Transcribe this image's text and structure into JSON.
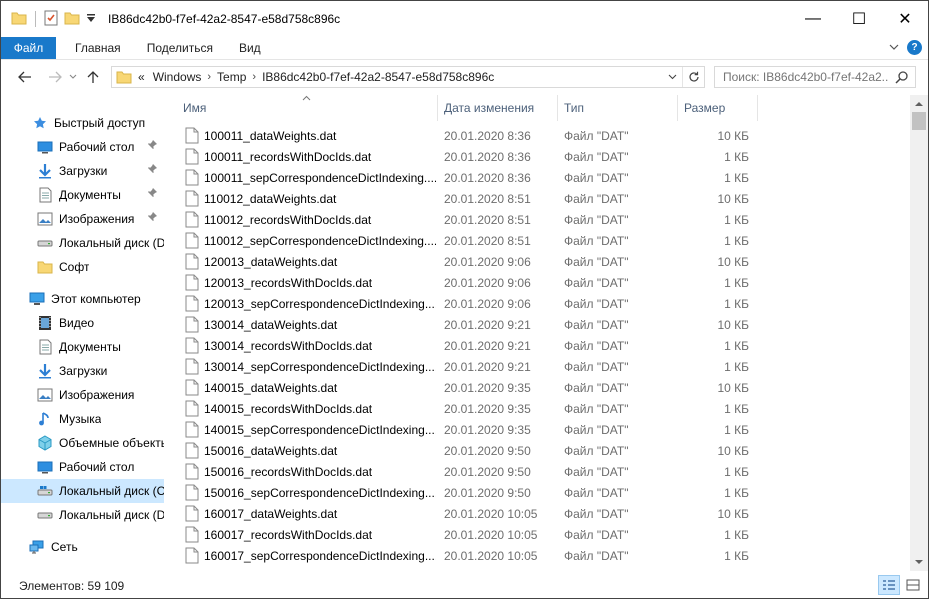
{
  "window": {
    "title": "IB86dc42b0-f7ef-42a2-8547-e58d758c896c",
    "minimize": "—",
    "maximize": "☐",
    "close": "✕"
  },
  "ribbon": {
    "tabs": [
      "Файл",
      "Главная",
      "Поделиться",
      "Вид"
    ]
  },
  "address": {
    "prefix": "«",
    "crumbs": [
      "Windows",
      "Temp",
      "IB86dc42b0-f7ef-42a2-8547-e58d758c896c"
    ]
  },
  "search": {
    "placeholder": "Поиск: IB86dc42b0-f7ef-42a2..."
  },
  "sidebar": {
    "items": [
      {
        "label": "Быстрый доступ",
        "icon": "star-icon",
        "pinned": false
      },
      {
        "label": "Рабочий стол",
        "icon": "desktop-icon",
        "pinned": true
      },
      {
        "label": "Загрузки",
        "icon": "download-icon",
        "pinned": true
      },
      {
        "label": "Документы",
        "icon": "documents-icon",
        "pinned": true
      },
      {
        "label": "Изображения",
        "icon": "pictures-icon",
        "pinned": true
      },
      {
        "label": "Локальный диск (D",
        "icon": "drive-icon",
        "pinned": false
      },
      {
        "label": "Софт",
        "icon": "folder-icon",
        "pinned": false
      },
      {
        "label": "Этот компьютер",
        "icon": "computer-icon",
        "pinned": false
      },
      {
        "label": "Видео",
        "icon": "video-icon",
        "pinned": false
      },
      {
        "label": "Документы",
        "icon": "documents-icon",
        "pinned": false
      },
      {
        "label": "Загрузки",
        "icon": "download-icon",
        "pinned": false
      },
      {
        "label": "Изображения",
        "icon": "pictures-icon",
        "pinned": false
      },
      {
        "label": "Музыка",
        "icon": "music-icon",
        "pinned": false
      },
      {
        "label": "Объемные объекты",
        "icon": "3d-objects-icon",
        "pinned": false
      },
      {
        "label": "Рабочий стол",
        "icon": "desktop-icon",
        "pinned": false
      },
      {
        "label": "Локальный диск (C",
        "icon": "drive-icon",
        "pinned": false
      },
      {
        "label": "Локальный диск (D",
        "icon": "drive-icon",
        "pinned": false
      },
      {
        "label": "Сеть",
        "icon": "network-icon",
        "pinned": false
      }
    ]
  },
  "columns": {
    "name": "Имя",
    "date": "Дата изменения",
    "type": "Тип",
    "size": "Размер"
  },
  "files": [
    {
      "name": "100011_dataWeights.dat",
      "date": "20.01.2020 8:36",
      "type": "Файл \"DAT\"",
      "size": "10 КБ"
    },
    {
      "name": "100011_recordsWithDocIds.dat",
      "date": "20.01.2020 8:36",
      "type": "Файл \"DAT\"",
      "size": "1 КБ"
    },
    {
      "name": "100011_sepCorrespondenceDictIndexing....",
      "date": "20.01.2020 8:36",
      "type": "Файл \"DAT\"",
      "size": "1 КБ"
    },
    {
      "name": "110012_dataWeights.dat",
      "date": "20.01.2020 8:51",
      "type": "Файл \"DAT\"",
      "size": "10 КБ"
    },
    {
      "name": "110012_recordsWithDocIds.dat",
      "date": "20.01.2020 8:51",
      "type": "Файл \"DAT\"",
      "size": "1 КБ"
    },
    {
      "name": "110012_sepCorrespondenceDictIndexing....",
      "date": "20.01.2020 8:51",
      "type": "Файл \"DAT\"",
      "size": "1 КБ"
    },
    {
      "name": "120013_dataWeights.dat",
      "date": "20.01.2020 9:06",
      "type": "Файл \"DAT\"",
      "size": "10 КБ"
    },
    {
      "name": "120013_recordsWithDocIds.dat",
      "date": "20.01.2020 9:06",
      "type": "Файл \"DAT\"",
      "size": "1 КБ"
    },
    {
      "name": "120013_sepCorrespondenceDictIndexing....",
      "date": "20.01.2020 9:06",
      "type": "Файл \"DAT\"",
      "size": "1 КБ"
    },
    {
      "name": "130014_dataWeights.dat",
      "date": "20.01.2020 9:21",
      "type": "Файл \"DAT\"",
      "size": "10 КБ"
    },
    {
      "name": "130014_recordsWithDocIds.dat",
      "date": "20.01.2020 9:21",
      "type": "Файл \"DAT\"",
      "size": "1 КБ"
    },
    {
      "name": "130014_sepCorrespondenceDictIndexing....",
      "date": "20.01.2020 9:21",
      "type": "Файл \"DAT\"",
      "size": "1 КБ"
    },
    {
      "name": "140015_dataWeights.dat",
      "date": "20.01.2020 9:35",
      "type": "Файл \"DAT\"",
      "size": "10 КБ"
    },
    {
      "name": "140015_recordsWithDocIds.dat",
      "date": "20.01.2020 9:35",
      "type": "Файл \"DAT\"",
      "size": "1 КБ"
    },
    {
      "name": "140015_sepCorrespondenceDictIndexing....",
      "date": "20.01.2020 9:35",
      "type": "Файл \"DAT\"",
      "size": "1 КБ"
    },
    {
      "name": "150016_dataWeights.dat",
      "date": "20.01.2020 9:50",
      "type": "Файл \"DAT\"",
      "size": "10 КБ"
    },
    {
      "name": "150016_recordsWithDocIds.dat",
      "date": "20.01.2020 9:50",
      "type": "Файл \"DAT\"",
      "size": "1 КБ"
    },
    {
      "name": "150016_sepCorrespondenceDictIndexing....",
      "date": "20.01.2020 9:50",
      "type": "Файл \"DAT\"",
      "size": "1 КБ"
    },
    {
      "name": "160017_dataWeights.dat",
      "date": "20.01.2020 10:05",
      "type": "Файл \"DAT\"",
      "size": "10 КБ"
    },
    {
      "name": "160017_recordsWithDocIds.dat",
      "date": "20.01.2020 10:05",
      "type": "Файл \"DAT\"",
      "size": "1 КБ"
    },
    {
      "name": "160017_sepCorrespondenceDictIndexing....",
      "date": "20.01.2020 10:05",
      "type": "Файл \"DAT\"",
      "size": "1 КБ"
    }
  ],
  "status": {
    "count": "Элементов: 59 109"
  },
  "colors": {
    "accent": "#1979ca",
    "selection": "#cce8ff",
    "header_text": "#4c607a",
    "folder": "#f8d775"
  }
}
